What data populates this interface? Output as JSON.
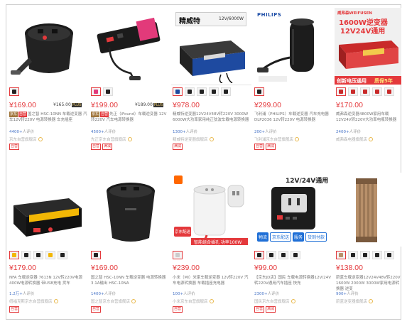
{
  "colors": {
    "price": "#e4393c",
    "link": "#4a76c7",
    "muted": "#999999"
  },
  "products": [
    {
      "price": "¥169.00",
      "alt_price": "¥165.00",
      "plus": "PLUS",
      "tags": [
        "京东",
        "自营"
      ],
      "title": "国之智 HSC-10NN 车载逆变器 汽车12V转220V 电源转换器 车充插座",
      "reviews_count": "4400+",
      "reviews_suffix": "人评价",
      "shop": "京东自营旗舰店",
      "badges": [
        "自营"
      ]
    },
    {
      "price": "¥199.00",
      "alt_price": "¥189.00",
      "plus": "PLUS",
      "tags": [
        "京东",
        "自营"
      ],
      "title": "先正（iFound）车载逆变器 12V转220V 汽车电源转换器",
      "reviews_count": "4500+",
      "reviews_suffix": "人评价",
      "shop": "先正京东自营旗舰店",
      "badges": [
        "自营",
        "满减"
      ]
    },
    {
      "price": "¥978.00",
      "brand_caption": "精威特",
      "spec_caption": "12V/6000W",
      "title": "精威特逆变器12V24V48V转220V 3000W 6000W大功率家用纯正弦波车载电源转换器",
      "reviews_count": "1300+",
      "reviews_suffix": "人评价",
      "shop": "精威特逆变器旗舰店",
      "badges": [
        "满减"
      ]
    },
    {
      "price": "¥299.00",
      "brand_caption": "PHILIPS",
      "title": "飞利浦（PHILIPS）车载逆变器 汽车充电器 DLP2036 12V转220V 电源转换器",
      "reviews_count": "200+",
      "reviews_suffix": "人评价",
      "shop": "飞利浦京东自营旗舰店",
      "badges": [
        "自营",
        "满减"
      ]
    },
    {
      "price": "¥170.00",
      "brand_caption": "威弗森WEIFUSEN",
      "banner_line1": "1600W逆变器",
      "banner_line2": "12V24V通用",
      "strip_left": "创新电压通用",
      "strip_right": "质保5年",
      "title": "威弗森逆变器4800W家用车载12V24V转220V大功率电瓶转换器",
      "reviews_count": "2400+",
      "reviews_suffix": "人评价",
      "shop": "威弗森电器旗舰店",
      "badges": []
    },
    {
      "price": "¥179.00",
      "title": "NFA 车载逆变器 7613N 12V转220V电源 400W电源转换器 带USB充电 货车",
      "reviews_count": "1.2万+",
      "reviews_suffix": "人评价",
      "shop": "纽福克斯京东自营旗舰店",
      "badges": [
        "自营"
      ]
    },
    {
      "price": "¥169.00",
      "title": "国之智 HSC-10NN 车载逆变器 电源转换器 3.1A输出 HSC-10NA",
      "reviews_count": "1400+",
      "reviews_suffix": "人评价",
      "shop": "国之智京东自营旗舰店",
      "badges": [
        "自营"
      ]
    },
    {
      "price": "¥239.00",
      "strip_text": "智能组合插孔 功率100W",
      "corner_badge": "京东配送",
      "title": "小米（MI）米家车载逆变器 12V转220V 汽车电源转换器 车载插座充电器",
      "reviews_count": "100+",
      "reviews_suffix": "人评价",
      "shop": "小米京东自营旗舰店",
      "badges": [
        "自营"
      ]
    },
    {
      "price": "¥99.00",
      "banner_line1": "12V/24V通用",
      "pills": [
        "物流",
        "京东配送",
        "服务",
        "货到付款"
      ],
      "title": "【京东JD店】国民 车载电源转换器12V/24V转220V通用汽车插座 快充",
      "reviews_count": "2300+",
      "reviews_suffix": "人评价",
      "shop": "国民京东自营旗舰店",
      "badges": [
        "自营",
        "满减"
      ]
    },
    {
      "price": "¥138.00",
      "title": "蔚蓝车载逆变器12V24V48V转220V 1600W 2000W 3000W家用电源转换器 逆变",
      "reviews_count": "900+",
      "reviews_suffix": "人评价",
      "shop": "蔚蓝逆变器旗舰店",
      "badges": []
    }
  ]
}
